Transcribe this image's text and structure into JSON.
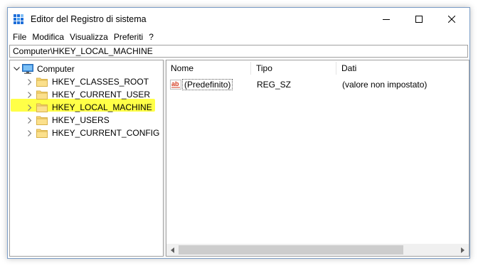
{
  "window": {
    "title": "Editor del Registro di sistema",
    "icon": "regedit-icon"
  },
  "menu": [
    "File",
    "Modifica",
    "Visualizza",
    "Preferiti",
    "?"
  ],
  "address": "Computer\\HKEY_LOCAL_MACHINE",
  "tree": {
    "root": "Computer",
    "children": [
      "HKEY_CLASSES_ROOT",
      "HKEY_CURRENT_USER",
      "HKEY_LOCAL_MACHINE",
      "HKEY_USERS",
      "HKEY_CURRENT_CONFIG"
    ],
    "highlighted": "HKEY_LOCAL_MACHINE",
    "highlight_color": "#ffff33"
  },
  "columns": [
    "Nome",
    "Tipo",
    "Dati"
  ],
  "rows": [
    {
      "name": "(Predefinito)",
      "type": "REG_SZ",
      "data": "(valore non impostato)",
      "icon": "string-value-icon"
    }
  ]
}
